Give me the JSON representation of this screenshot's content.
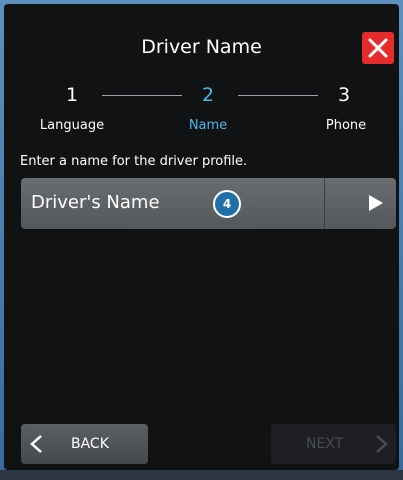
{
  "header": {
    "title": "Driver Name",
    "close_icon": "close-icon",
    "close_color": "#e52b2b"
  },
  "stepper": {
    "steps": [
      {
        "number": "1",
        "label": "Language",
        "active": false
      },
      {
        "number": "2",
        "label": "Name",
        "active": true
      },
      {
        "number": "3",
        "label": "Phone",
        "active": false
      }
    ],
    "active_color": "#4db8e8"
  },
  "instruction": "Enter a name for the driver profile.",
  "name_field": {
    "label": "Driver's Name",
    "badge": "4",
    "arrow_icon": "play-arrow-icon"
  },
  "footer": {
    "back_label": "BACK",
    "next_label": "NEXT",
    "next_enabled": false
  }
}
